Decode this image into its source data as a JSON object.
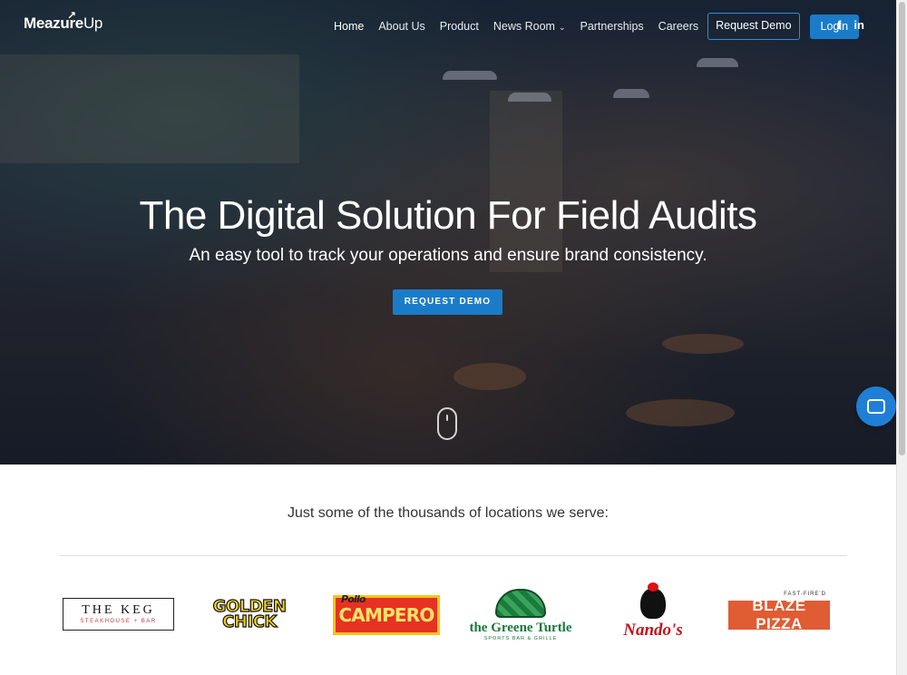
{
  "header": {
    "logo_bold": "Meazure",
    "logo_light": "Up",
    "nav": [
      {
        "label": "Home"
      },
      {
        "label": "About Us"
      },
      {
        "label": "Product"
      },
      {
        "label": "News Room"
      },
      {
        "label": "Partnerships"
      },
      {
        "label": "Careers"
      }
    ],
    "request_demo": "Request Demo",
    "login": "Login",
    "social": {
      "facebook": "f",
      "linkedin": "in"
    }
  },
  "hero": {
    "title": "The Digital Solution For Field Audits",
    "subtitle": "An easy tool to track your operations and ensure brand consistency.",
    "cta": "REQUEST DEMO"
  },
  "clients": {
    "heading": "Just some of the thousands of locations we serve:",
    "logos": [
      {
        "name": "THE KEG",
        "sub": "STEAKHOUSE + BAR"
      },
      {
        "name_line1": "GOLDEN",
        "name_line2": "CHICK"
      },
      {
        "name_top": "Pollo",
        "name": "CAMPERO"
      },
      {
        "name": "the Greene Turtle",
        "sub": "SPORTS BAR & GRILLE"
      },
      {
        "name": "Nando's"
      },
      {
        "name": "BLAZE PIZZA",
        "sub": "FAST-FIRE'D"
      }
    ]
  },
  "colors": {
    "accent": "#1a7cc9",
    "hero_overlay": "#0a1428"
  }
}
